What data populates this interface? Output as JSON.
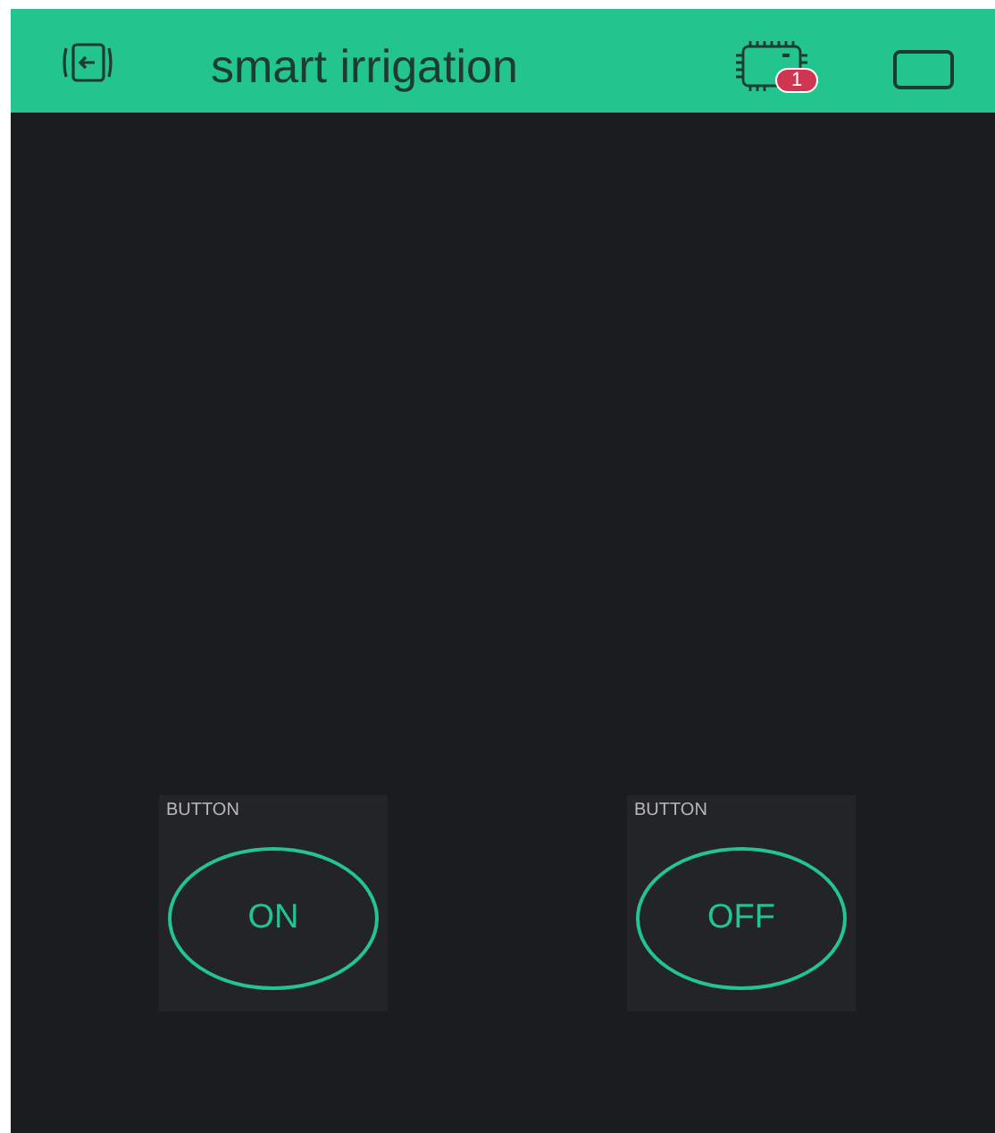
{
  "header": {
    "title": "smart irrigation",
    "device_badge": "1"
  },
  "widgets": [
    {
      "kind": "button",
      "label": "BUTTON",
      "text": "ON"
    },
    {
      "kind": "button",
      "label": "BUTTON",
      "text": "OFF"
    }
  ]
}
